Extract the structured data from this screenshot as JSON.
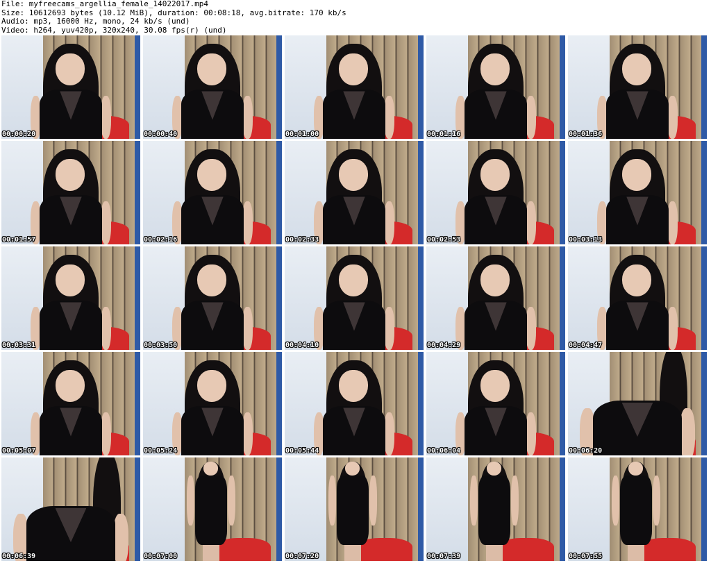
{
  "info": {
    "line1": "File: myfreecams_argellia_female_14022017.mp4",
    "line2": "Size: 10612693 bytes (10.12 MiB), duration: 00:08:18, avg.bitrate: 170 kb/s",
    "line3": "Audio: mp3, 16000 Hz, mono, 24 kb/s (und)",
    "line4": "Video: h264, yuv420p, 320x240, 30.08 fps(r) (und)"
  },
  "thumbnails": [
    {
      "time": "00:00:20",
      "shot": "mid"
    },
    {
      "time": "00:00:40",
      "shot": "mid"
    },
    {
      "time": "00:01:00",
      "shot": "mid"
    },
    {
      "time": "00:01:16",
      "shot": "mid"
    },
    {
      "time": "00:01:36",
      "shot": "mid"
    },
    {
      "time": "00:01:57",
      "shot": "mid"
    },
    {
      "time": "00:02:16",
      "shot": "mid"
    },
    {
      "time": "00:02:33",
      "shot": "mid"
    },
    {
      "time": "00:02:53",
      "shot": "mid"
    },
    {
      "time": "00:03:13",
      "shot": "mid"
    },
    {
      "time": "00:03:31",
      "shot": "mid"
    },
    {
      "time": "00:03:50",
      "shot": "mid"
    },
    {
      "time": "00:04:10",
      "shot": "mid"
    },
    {
      "time": "00:04:29",
      "shot": "mid"
    },
    {
      "time": "00:04:47",
      "shot": "mid"
    },
    {
      "time": "00:05:07",
      "shot": "mid"
    },
    {
      "time": "00:05:24",
      "shot": "mid"
    },
    {
      "time": "00:05:44",
      "shot": "mid"
    },
    {
      "time": "00:06:04",
      "shot": "mid"
    },
    {
      "time": "00:06:20",
      "shot": "close"
    },
    {
      "time": "00:06:39",
      "shot": "close"
    },
    {
      "time": "00:07:00",
      "shot": "full"
    },
    {
      "time": "00:07:20",
      "shot": "full"
    },
    {
      "time": "00:07:39",
      "shot": "full"
    },
    {
      "time": "00:07:55",
      "shot": "full"
    }
  ]
}
